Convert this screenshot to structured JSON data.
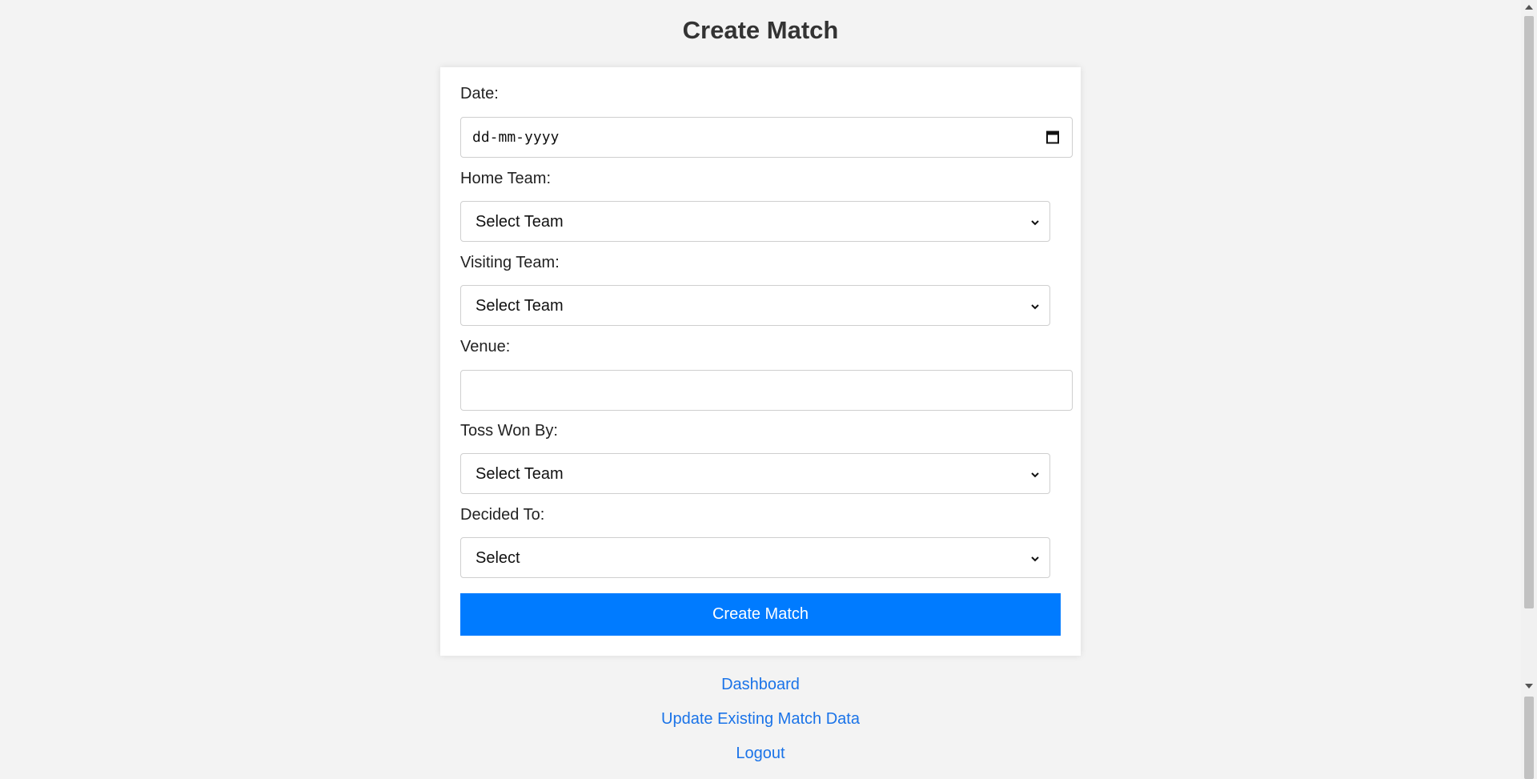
{
  "page": {
    "title": "Create Match"
  },
  "form": {
    "date": {
      "label": "Date:",
      "placeholder": "dd-mm-yyyy",
      "icon": "calendar-icon"
    },
    "home_team": {
      "label": "Home Team:",
      "selected": "Select Team"
    },
    "visiting_team": {
      "label": "Visiting Team:",
      "selected": "Select Team"
    },
    "venue": {
      "label": "Venue:",
      "value": ""
    },
    "toss_won_by": {
      "label": "Toss Won By:",
      "selected": "Select Team"
    },
    "decided_to": {
      "label": "Decided To:",
      "selected": "Select"
    },
    "submit_label": "Create Match"
  },
  "links": {
    "dashboard": "Dashboard",
    "update_match": "Update Existing Match Data",
    "logout": "Logout"
  },
  "colors": {
    "accent": "#007bff",
    "link": "#1a73e8",
    "background": "#f3f3f3"
  }
}
